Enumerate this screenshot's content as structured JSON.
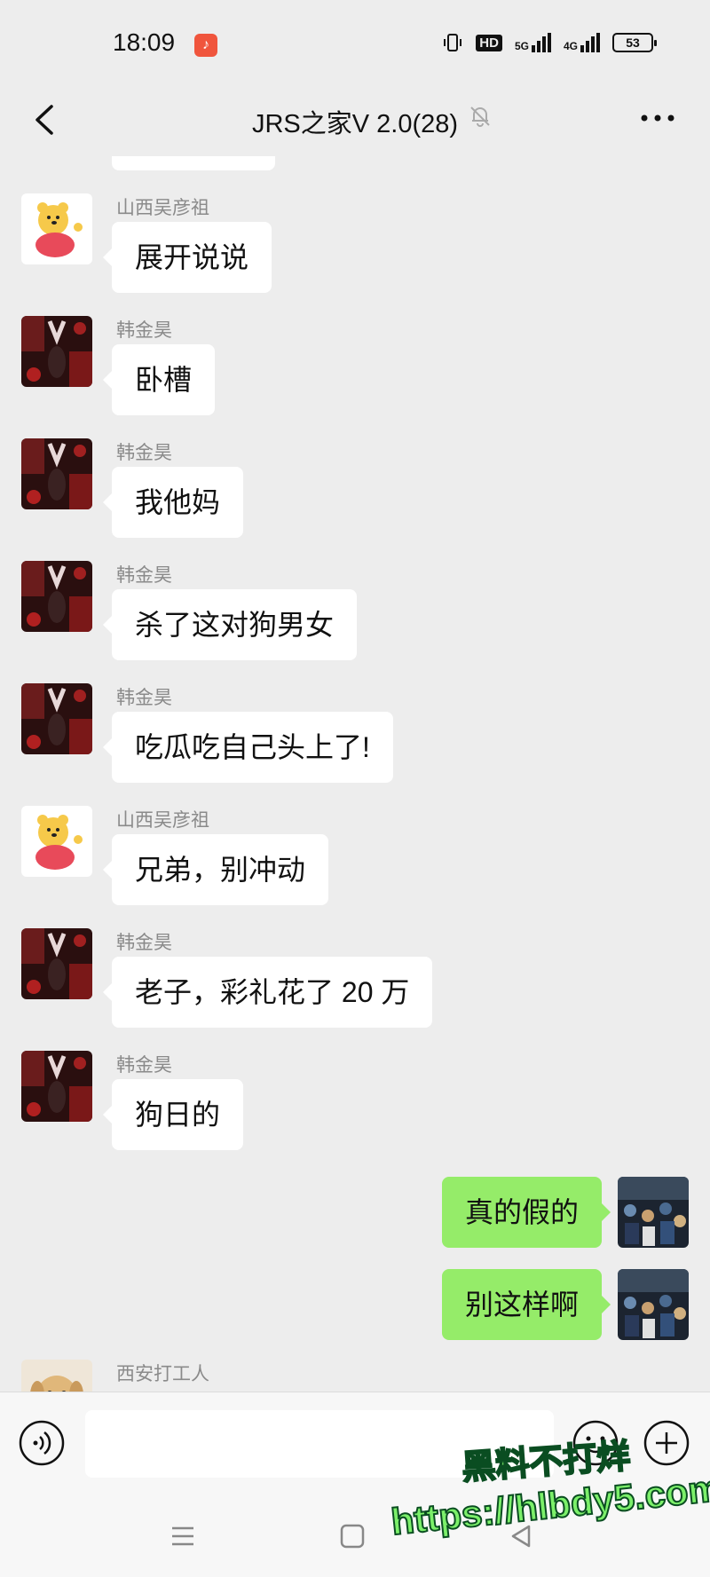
{
  "status_bar": {
    "time": "18:09",
    "hd_label": "HD",
    "net_5g": "5G",
    "net_4g": "4G",
    "battery": "53"
  },
  "nav": {
    "title": "JRS之家V 2.0(28)"
  },
  "messages": [
    {
      "sender": "山西吴彦祖",
      "text": "展开说说",
      "side": "left",
      "avatar": "pooh-avatar"
    },
    {
      "sender": "韩金昊",
      "text": "卧槽",
      "side": "left",
      "avatar": "dark-avatar"
    },
    {
      "sender": "韩金昊",
      "text": "我他妈",
      "side": "left",
      "avatar": "dark-avatar"
    },
    {
      "sender": "韩金昊",
      "text": "杀了这对狗男女",
      "side": "left",
      "avatar": "dark-avatar"
    },
    {
      "sender": "韩金昊",
      "text": "吃瓜吃自己头上了!",
      "side": "left",
      "avatar": "dark-avatar"
    },
    {
      "sender": "山西吴彦祖",
      "text": "兄弟，别冲动",
      "side": "left",
      "avatar": "pooh-avatar"
    },
    {
      "sender": "韩金昊",
      "text": "老子，彩礼花了 20 万",
      "side": "left",
      "avatar": "dark-avatar"
    },
    {
      "sender": "韩金昊",
      "text": "狗日的",
      "side": "left",
      "avatar": "dark-avatar"
    },
    {
      "text": "真的假的",
      "side": "right",
      "avatar": "crowd-avatar"
    },
    {
      "text": "别这样啊",
      "side": "right",
      "avatar": "crowd-avatar"
    },
    {
      "sender": "西安打工人",
      "side": "left",
      "avatar": "dog-avatar"
    }
  ],
  "watermark": {
    "line1": "黑料不打烊",
    "line2": "https://hlbdy5.com"
  },
  "colors": {
    "background": "#ededed",
    "own_bubble": "#95ec69",
    "other_bubble": "#ffffff",
    "sender_name": "#8a8a8a"
  }
}
